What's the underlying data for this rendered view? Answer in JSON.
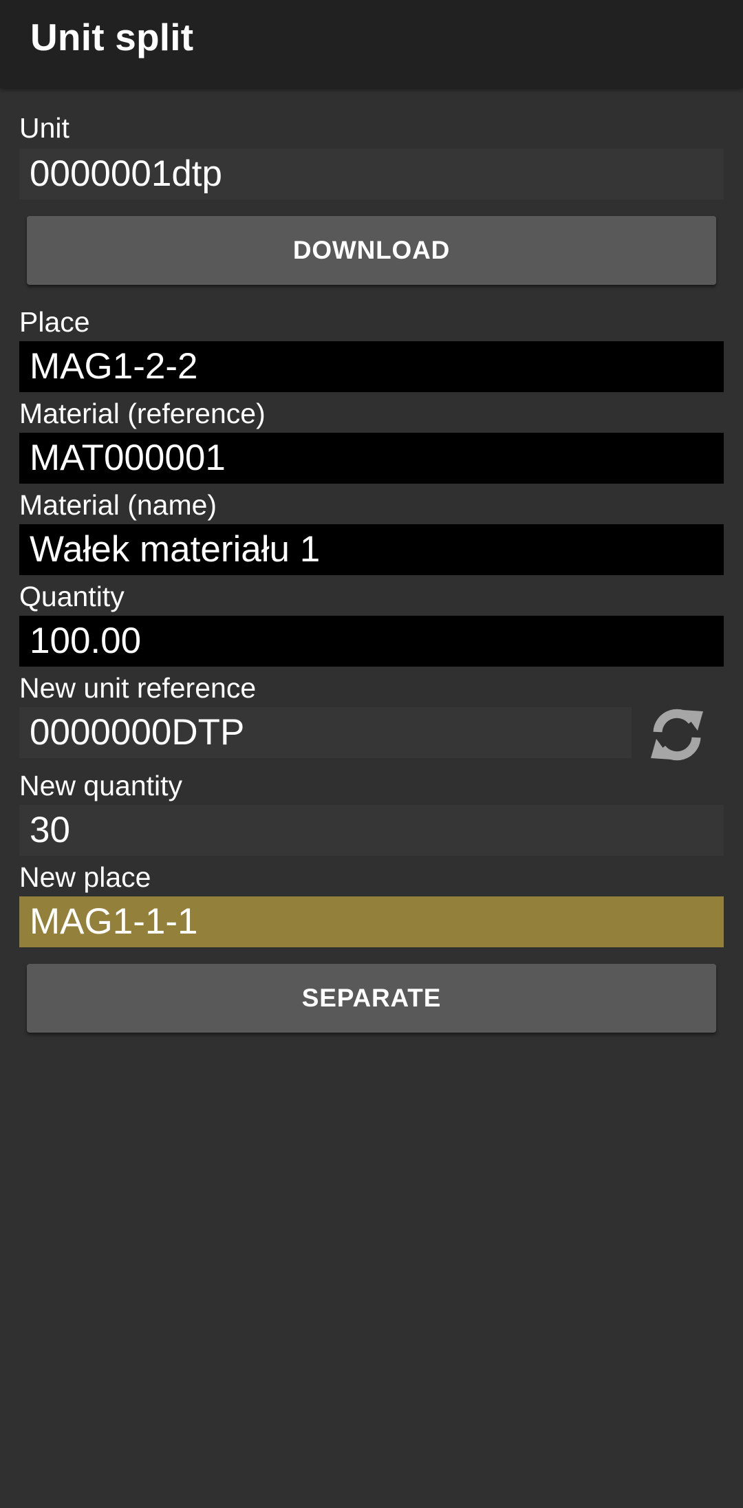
{
  "app": {
    "title": "Unit split"
  },
  "form": {
    "unit": {
      "label": "Unit",
      "value": "0000001dtp"
    },
    "download_button": "DOWNLOAD",
    "place": {
      "label": "Place",
      "value": "MAG1-2-2"
    },
    "material_reference": {
      "label": "Material (reference)",
      "value": "MAT000001"
    },
    "material_name": {
      "label": "Material (name)",
      "value": "Wałek materiału 1"
    },
    "quantity": {
      "label": "Quantity",
      "value": "100.00"
    },
    "new_unit_reference": {
      "label": "New unit reference",
      "value": "0000000DTP",
      "refresh_icon": "refresh-icon"
    },
    "new_quantity": {
      "label": "New quantity",
      "value": "30"
    },
    "new_place": {
      "label": "New place",
      "value": "MAG1-1-1"
    },
    "separate_button": "SEPARATE"
  },
  "colors": {
    "background": "#303030",
    "appbar": "#212121",
    "button": "#595959",
    "readonly_field": "#000000",
    "highlight_field": "#93803a"
  }
}
